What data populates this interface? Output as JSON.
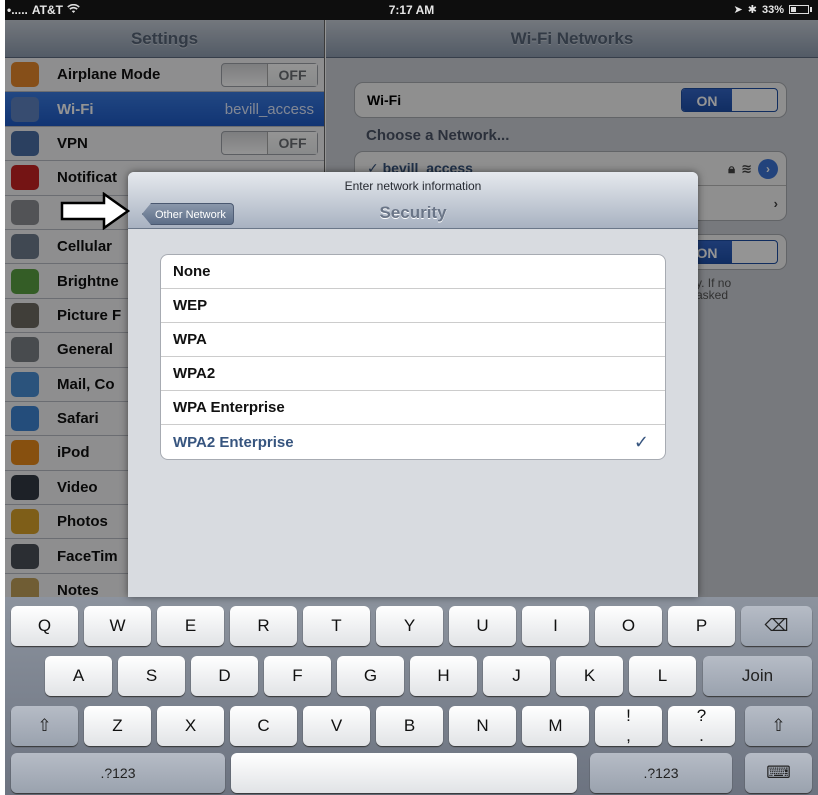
{
  "status": {
    "carrier": "AT&T",
    "time": "7:17 AM",
    "battery": "33%"
  },
  "settings": {
    "title": "Settings",
    "items": [
      {
        "label": "Airplane Mode",
        "value": "OFF",
        "icon": "airplane-icon",
        "color": "#e7892b"
      },
      {
        "label": "Wi-Fi",
        "value": "bevill_access",
        "icon": "wifi-icon",
        "color": "#5f83c2"
      },
      {
        "label": "VPN",
        "value": "OFF",
        "icon": "vpn-icon",
        "color": "#4a6fa5"
      },
      {
        "label": "Notificat",
        "icon": "notifications-icon",
        "color": "#c82323"
      },
      {
        "label": "",
        "icon": "location-icon",
        "color": "#8d8f94"
      },
      {
        "label": "Cellular",
        "icon": "cellular-icon",
        "color": "#6f7d8d"
      },
      {
        "label": "Brightne",
        "icon": "brightness-icon",
        "color": "#5aa043"
      },
      {
        "label": "Picture F",
        "icon": "picture-frame-icon",
        "color": "#6f6c62"
      },
      {
        "label": "General",
        "icon": "gear-icon",
        "color": "#7d8187"
      },
      {
        "label": "Mail, Co",
        "icon": "mail-icon",
        "color": "#4a8fd6"
      },
      {
        "label": "Safari",
        "icon": "safari-icon",
        "color": "#3f86d4"
      },
      {
        "label": "iPod",
        "icon": "ipod-icon",
        "color": "#e88b1a"
      },
      {
        "label": "Video",
        "icon": "video-icon",
        "color": "#333a44"
      },
      {
        "label": "Photos",
        "icon": "photos-icon",
        "color": "#d9a32a"
      },
      {
        "label": "FaceTim",
        "icon": "facetime-icon",
        "color": "#4b5058"
      },
      {
        "label": "Notes",
        "icon": "notes-icon",
        "color": "#c2a15b"
      }
    ]
  },
  "wifi": {
    "title": "Wi-Fi Networks",
    "wifi_label": "Wi-Fi",
    "wifi_toggle": "ON",
    "choose_label": "Choose a Network...",
    "network": "✓ bevill_access",
    "ask_toggle": "ON",
    "ask_note_1": "y. If no",
    "ask_note_2": "asked"
  },
  "sheet": {
    "prompt": "Enter network information",
    "title": "Security",
    "back": "Other Network",
    "options": [
      "None",
      "WEP",
      "WPA",
      "WPA2",
      "WPA Enterprise",
      "WPA2 Enterprise"
    ],
    "selected": "WPA2 Enterprise",
    "checkmark": "✓"
  },
  "keyboard": {
    "row1": [
      "Q",
      "W",
      "E",
      "R",
      "T",
      "Y",
      "U",
      "I",
      "O",
      "P"
    ],
    "backspace": "⌫",
    "row2": [
      "A",
      "S",
      "D",
      "F",
      "G",
      "H",
      "J",
      "K",
      "L"
    ],
    "join": "Join",
    "shift": "⇧",
    "row3": [
      "Z",
      "X",
      "C",
      "V",
      "B",
      "N",
      "M",
      "!\n,",
      "?\n."
    ],
    "numbers": ".?123",
    "hide": "⌨"
  }
}
